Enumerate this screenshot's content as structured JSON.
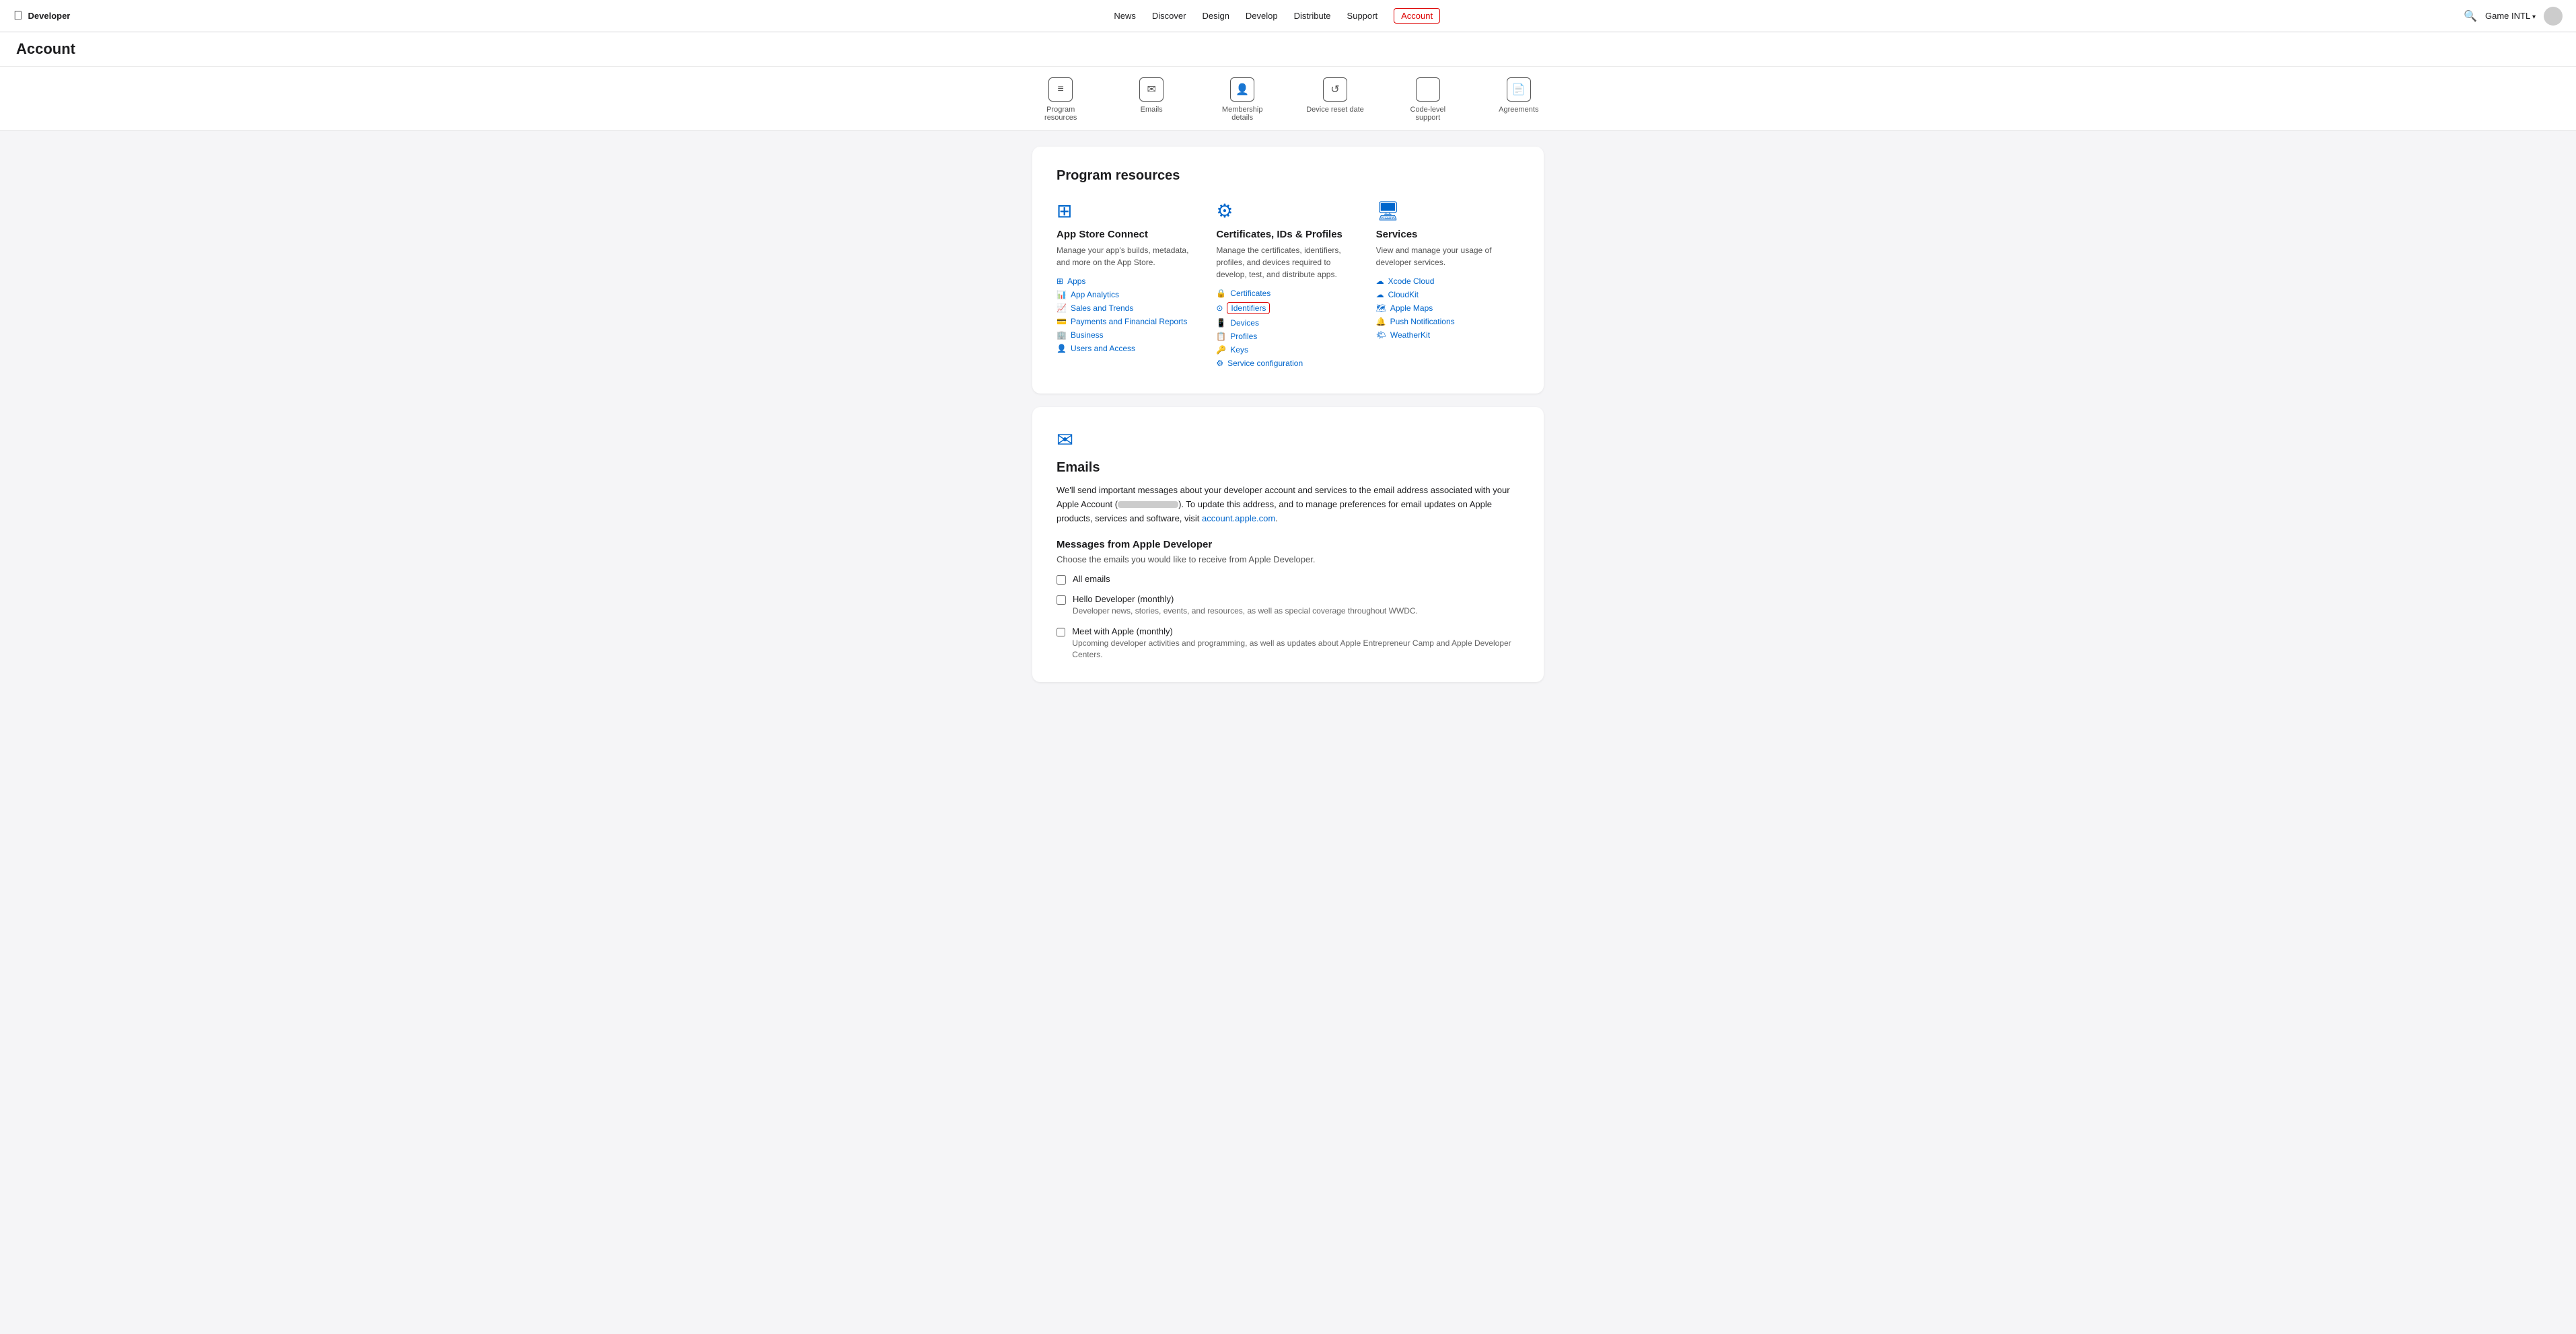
{
  "nav": {
    "logo": "",
    "brand": "Developer",
    "links": [
      {
        "label": "News",
        "active": false
      },
      {
        "label": "Discover",
        "active": false
      },
      {
        "label": "Design",
        "active": false
      },
      {
        "label": "Develop",
        "active": false
      },
      {
        "label": "Distribute",
        "active": false
      },
      {
        "label": "Support",
        "active": false
      },
      {
        "label": "Account",
        "active": true
      }
    ],
    "account_name": "Game INTL",
    "search_icon": "🔍"
  },
  "page": {
    "title": "Account"
  },
  "icon_nav": {
    "items": [
      {
        "icon": "≡",
        "label": "Program resources"
      },
      {
        "icon": "✉",
        "label": "Emails"
      },
      {
        "icon": "👤",
        "label": "Membership details"
      },
      {
        "icon": "↺",
        "label": "Device reset date"
      },
      {
        "icon": "</>",
        "label": "Code-level support"
      },
      {
        "icon": "📄",
        "label": "Agreements"
      }
    ]
  },
  "program_resources": {
    "section_title": "Program resources",
    "columns": [
      {
        "icon": "⊞",
        "title": "App Store Connect",
        "description": "Manage your app's builds, metadata, and more on the App Store.",
        "links": [
          {
            "icon": "⊞",
            "label": "Apps"
          },
          {
            "icon": "📊",
            "label": "App Analytics"
          },
          {
            "icon": "📈",
            "label": "Sales and Trends"
          },
          {
            "icon": "💳",
            "label": "Payments and Financial Reports"
          },
          {
            "icon": "🏢",
            "label": "Business"
          },
          {
            "icon": "👤",
            "label": "Users and Access"
          }
        ]
      },
      {
        "icon": "⚙",
        "title": "Certificates, IDs & Profiles",
        "description": "Manage the certificates, identifiers, profiles, and devices required to develop, test, and distribute apps.",
        "links": [
          {
            "icon": "🔒",
            "label": "Certificates"
          },
          {
            "icon": "⊙",
            "label": "Identifiers",
            "highlighted": true
          },
          {
            "icon": "📱",
            "label": "Devices"
          },
          {
            "icon": "📋",
            "label": "Profiles"
          },
          {
            "icon": "🔑",
            "label": "Keys"
          },
          {
            "icon": "⚙",
            "label": "Service configuration"
          }
        ]
      },
      {
        "icon": "🖥",
        "title": "Services",
        "description": "View and manage your usage of developer services.",
        "links": [
          {
            "icon": "☁",
            "label": "Xcode Cloud"
          },
          {
            "icon": "☁",
            "label": "CloudKit"
          },
          {
            "icon": "🗺",
            "label": "Apple Maps"
          },
          {
            "icon": "🔔",
            "label": "Push Notifications"
          },
          {
            "icon": "🌤",
            "label": "WeatherKit"
          }
        ]
      }
    ]
  },
  "emails": {
    "icon": "✉",
    "title": "Emails",
    "body_text_before": "We'll send important messages about your developer account and services to the email address associated with your Apple Account (",
    "body_text_after": "). To update this address, and to manage preferences for email updates on Apple products, services and software, visit ",
    "email_link_label": "account.apple.com",
    "email_link_url": "https://account.apple.com",
    "body_text_end": ".",
    "messages_title": "Messages from Apple Developer",
    "messages_subtitle": "Choose the emails you would like to receive from Apple Developer.",
    "all_emails_label": "All emails",
    "checkboxes": [
      {
        "label": "Hello Developer (monthly)",
        "description": "Developer news, stories, events, and resources, as well as special coverage throughout WWDC."
      },
      {
        "label": "Meet with Apple (monthly)",
        "description": "Upcoming developer activities and programming, as well as updates about Apple Entrepreneur Camp and Apple Developer Centers."
      }
    ]
  }
}
